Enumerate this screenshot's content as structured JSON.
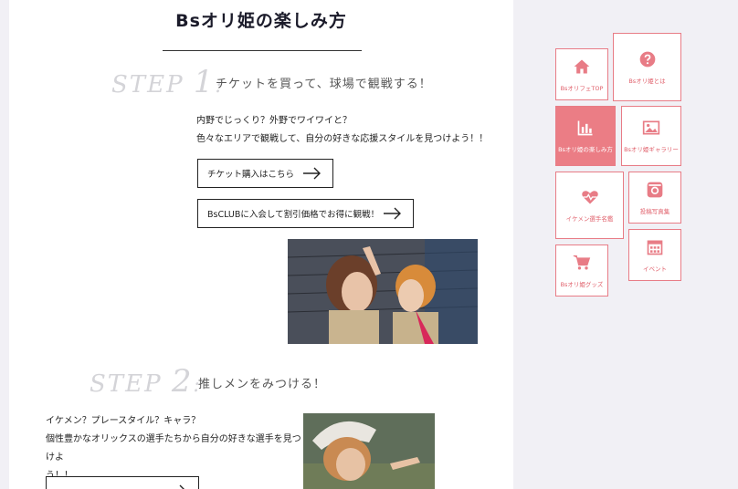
{
  "page": {
    "title": "Bsオリ姫の楽しみ方"
  },
  "steps": [
    {
      "word": "STEP",
      "number": "1",
      "colon": ":",
      "text": "チケットを買って、球場で観戦する！",
      "lines": [
        "内野でじっくり？外野でワイワイと？",
        "色々なエリアで観戦して、自分の好きな応援スタイルを見つけよう！！"
      ],
      "buttons": [
        "チケット購入はこちら",
        "BsCLUBに入会して割引価格でお得に観戦！"
      ]
    },
    {
      "word": "STEP",
      "number": "2",
      "colon": ":",
      "text": "推しメンをみつける！",
      "lines": [
        "イケメン？プレースタイル？キャラ？",
        "個性豊かなオリックスの選手たちから自分の好きな選手を見つけよ",
        "う！！"
      ]
    }
  ],
  "nav": {
    "accent": "#eb7d85",
    "items": [
      {
        "label": "BsオリフェTOP",
        "icon": "home-icon"
      },
      {
        "label": "Bsオリ姫とは",
        "icon": "question-icon"
      },
      {
        "label": "Bsオリ姫の楽しみ方",
        "icon": "bar-chart-icon",
        "active": true
      },
      {
        "label": "Bsオリ姫ギャラリー",
        "icon": "image-icon"
      },
      {
        "label": "イケメン選手名鑑",
        "icon": "heart-pulse-icon"
      },
      {
        "label": "投稿写真集",
        "icon": "camera-icon"
      },
      {
        "label": "イベント",
        "icon": "calendar-icon"
      },
      {
        "label": "Bsオリ姫グッズ",
        "icon": "cart-icon"
      }
    ]
  }
}
